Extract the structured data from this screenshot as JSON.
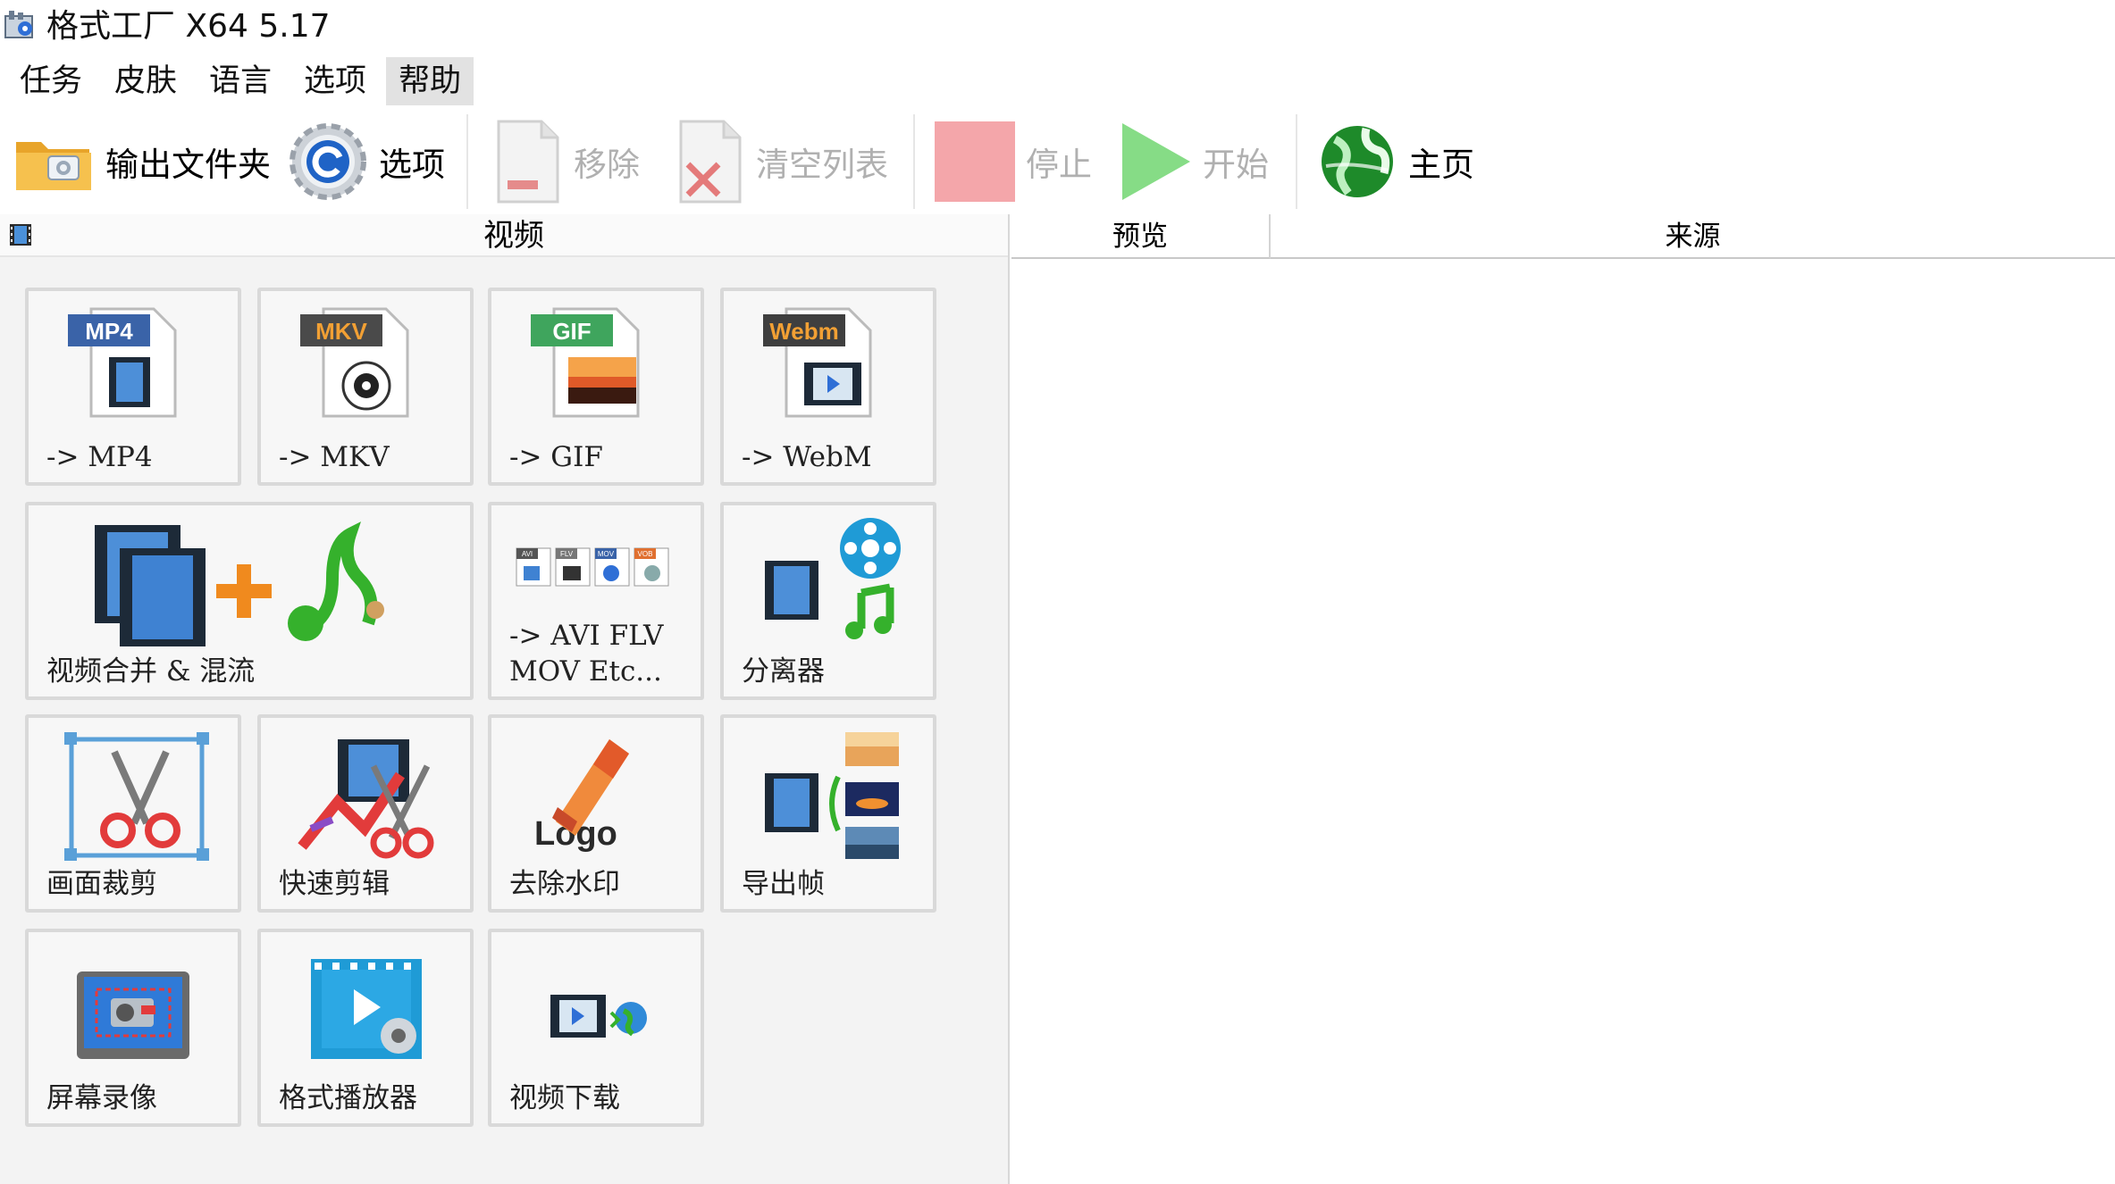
{
  "window": {
    "title": "格式工厂 X64 5.17"
  },
  "menu": [
    "任务",
    "皮肤",
    "语言",
    "选项",
    "帮助"
  ],
  "toolbar": {
    "output_folder": "输出文件夹",
    "options": "选项",
    "remove": "移除",
    "clear_list": "清空列表",
    "stop": "停止",
    "start": "开始",
    "home": "主页"
  },
  "category": {
    "title": "视频"
  },
  "tiles": {
    "mp4": {
      "label": "-> MP4",
      "badge": "MP4"
    },
    "mkv": {
      "label": "-> MKV",
      "badge": "MKV"
    },
    "gif": {
      "label": "-> GIF",
      "badge": "GIF"
    },
    "webm": {
      "label": "-> WebM",
      "badge": "Webm"
    },
    "merge": {
      "label": "视频合并 & 混流"
    },
    "others": {
      "label": "-> AVI FLV\nMOV Etc...",
      "badges": [
        "AVI",
        "FLV",
        "MOV",
        "VOB"
      ]
    },
    "splitter": {
      "label": "分离器"
    },
    "crop": {
      "label": "画面裁剪"
    },
    "quickcut": {
      "label": "快速剪辑"
    },
    "watermark": {
      "label": "去除水印",
      "logo_text": "Logo"
    },
    "frames": {
      "label": "导出帧"
    },
    "recorder": {
      "label": "屏幕录像"
    },
    "player": {
      "label": "格式播放器"
    },
    "download": {
      "label": "视频下载"
    }
  },
  "table": {
    "columns": [
      "预览",
      "来源"
    ]
  },
  "colors": {
    "stop_disabled": "#f4a6aa",
    "start_disabled": "#86dc86",
    "menu_active_bg": "#e2e2e2",
    "tile_border": "#d9d9d9"
  }
}
